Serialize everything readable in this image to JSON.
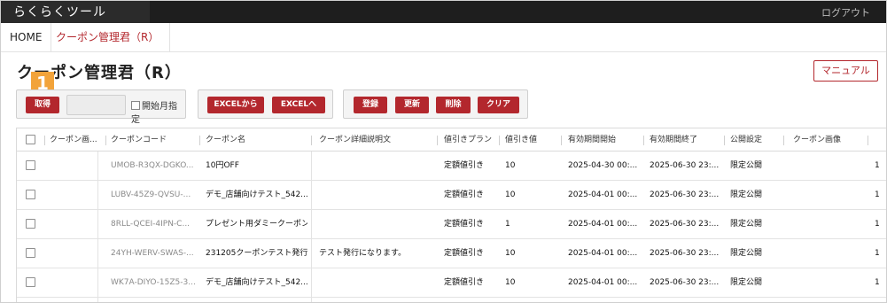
{
  "topbar": {
    "app_name": "らくらくツール",
    "logout_label": "ログアウト"
  },
  "breadcrumb": {
    "home": "HOME",
    "current": "クーポン管理君（R）"
  },
  "page": {
    "title": "クーポン管理君（R）",
    "manual_label": "マニュアル",
    "step_badge": "1"
  },
  "toolbar": {
    "get_label": "取得",
    "month_input_value": "",
    "month_checkbox_label": "開始月指定",
    "excel_from_label": "EXCELから",
    "excel_to_label": "EXCELへ",
    "register_label": "登録",
    "update_label": "更新",
    "delete_label": "削除",
    "clear_label": "クリア"
  },
  "table": {
    "headers": [
      "クーポン画...",
      "クーポンコード",
      "クーポン名",
      "クーポン詳細説明文",
      "値引きプラン",
      "値引き値",
      "有効期間開始",
      "有効期間終了",
      "公開設定",
      "クーポン画像"
    ],
    "rows": [
      {
        "image": "",
        "code": "UMOB-R3QX-DGKO...",
        "name": "10円OFF",
        "desc": "",
        "plan": "定額値引き",
        "value": "10",
        "start": "2025-04-30 00:...",
        "end": "2025-06-30 23:...",
        "visibility": "限定公開",
        "img2": "",
        "tail": "1"
      },
      {
        "image": "",
        "code": "LUBV-45Z9-QVSU-...",
        "name": "デモ_店舗向けテスト_542...",
        "desc": "",
        "plan": "定額値引き",
        "value": "10",
        "start": "2025-04-01 00:...",
        "end": "2025-06-30 23:...",
        "visibility": "限定公開",
        "img2": "",
        "tail": "1"
      },
      {
        "image": "",
        "code": "8RLL-QCEI-4IPN-C...",
        "name": "プレゼント用ダミークーポン",
        "desc": "",
        "plan": "定額値引き",
        "value": "1",
        "start": "2025-04-01 00:...",
        "end": "2025-06-30 23:...",
        "visibility": "限定公開",
        "img2": "",
        "tail": "1"
      },
      {
        "image": "",
        "code": "24YH-WERV-SWAS-...",
        "name": "231205クーポンテスト発行",
        "desc": "テスト発行になります。",
        "plan": "定額値引き",
        "value": "10",
        "start": "2025-04-01 00:...",
        "end": "2025-06-30 23:...",
        "visibility": "限定公開",
        "img2": "",
        "tail": "1"
      },
      {
        "image": "",
        "code": "WK7A-DIYO-15Z5-3...",
        "name": "デモ_店舗向けテスト_542...",
        "desc": "",
        "plan": "定額値引き",
        "value": "10",
        "start": "2025-04-01 00:...",
        "end": "2025-06-30 23:...",
        "visibility": "限定公開",
        "img2": "",
        "tail": "1"
      }
    ]
  },
  "colors": {
    "accent": "#b3272d",
    "topbar": "#2b2b2b",
    "badge": "#f2a33a"
  }
}
